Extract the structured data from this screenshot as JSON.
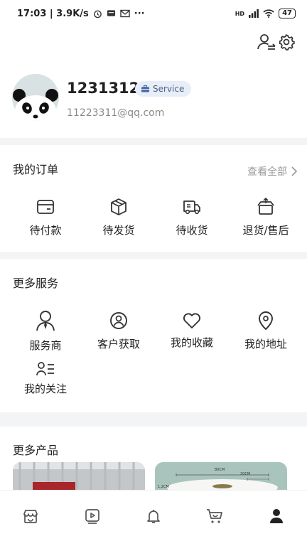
{
  "status_bar": {
    "left_text": "17:03 | 3.9K/s",
    "more": "···",
    "network": "HD",
    "battery": "47"
  },
  "profile": {
    "username": "1231312",
    "badge_label": "Service",
    "email": "11223311@qq.com"
  },
  "orders": {
    "title": "我的订单",
    "view_all": "查看全部",
    "items": [
      {
        "label": "待付款",
        "icon": "wallet-icon"
      },
      {
        "label": "待发货",
        "icon": "package-icon"
      },
      {
        "label": "待收货",
        "icon": "delivery-truck-icon"
      },
      {
        "label": "退货/售后",
        "icon": "return-box-icon"
      }
    ]
  },
  "services": {
    "title": "更多服务",
    "items": [
      {
        "label": "服务商",
        "icon": "provider-icon"
      },
      {
        "label": "客户获取",
        "icon": "customer-icon"
      },
      {
        "label": "我的收藏",
        "icon": "heart-icon"
      },
      {
        "label": "我的地址",
        "icon": "location-pin-icon"
      },
      {
        "label": "我的关注",
        "icon": "follow-list-icon"
      }
    ]
  },
  "products": {
    "title": "更多产品",
    "dim_labels": [
      "80CM",
      "20CM",
      "1.2CM"
    ]
  },
  "tabbar": {
    "items": [
      {
        "icon": "shop-icon",
        "active": false
      },
      {
        "icon": "video-icon",
        "active": false
      },
      {
        "icon": "bell-icon",
        "active": false
      },
      {
        "icon": "cart-icon",
        "active": false
      },
      {
        "icon": "user-icon",
        "active": true
      }
    ]
  },
  "colors": {
    "background": "#f3f4f6",
    "text": "#222222",
    "muted": "#8a8a8a",
    "badge_bg": "#e8eef7",
    "badge_text": "#4a5f86"
  }
}
